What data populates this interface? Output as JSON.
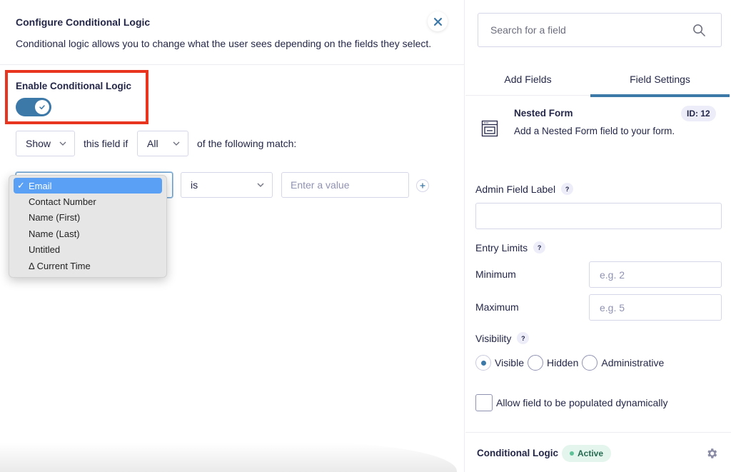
{
  "dialog": {
    "title": "Configure Conditional Logic",
    "description": "Conditional logic allows you to change what the user sees depending on the fields they select.",
    "close_icon": "close-icon"
  },
  "enable": {
    "label": "Enable Conditional Logic",
    "enabled": true
  },
  "rule_header": {
    "action_value": "Show",
    "text_this_field": "this field if",
    "logic_value": "All",
    "text_following": "of the following match:"
  },
  "rule": {
    "field_value": "Email",
    "operator_value": "is",
    "value_placeholder": "Enter a value",
    "add_icon": "plus-icon"
  },
  "field_dropdown": {
    "options": [
      {
        "label": "Email",
        "selected": true
      },
      {
        "label": "Contact Number",
        "selected": false
      },
      {
        "label": "Name (First)",
        "selected": false
      },
      {
        "label": "Name (Last)",
        "selected": false
      },
      {
        "label": "Untitled",
        "selected": false
      },
      {
        "label": "Δ Current Time",
        "selected": false
      }
    ],
    "check_glyph": "✓"
  },
  "sidebar": {
    "search_placeholder": "Search for a field",
    "tabs": [
      {
        "label": "Add Fields",
        "active": false
      },
      {
        "label": "Field Settings",
        "active": true
      }
    ],
    "field": {
      "name": "Nested Form",
      "description": "Add a Nested Form field to your form.",
      "id_badge": "ID: 12",
      "icon": "nested-form-icon"
    },
    "admin_label": {
      "label": "Admin Field Label",
      "help": "?",
      "value": ""
    },
    "entry_limits": {
      "label": "Entry Limits",
      "help": "?",
      "minimum_label": "Minimum",
      "minimum_placeholder": "e.g. 2",
      "maximum_label": "Maximum",
      "maximum_placeholder": "e.g. 5"
    },
    "visibility": {
      "label": "Visibility",
      "help": "?",
      "options": [
        {
          "label": "Visible",
          "checked": true
        },
        {
          "label": "Hidden",
          "checked": false
        },
        {
          "label": "Administrative",
          "checked": false
        }
      ]
    },
    "dynamic_population": {
      "label": "Allow field to be populated dynamically",
      "checked": false
    },
    "conditional_logic": {
      "label": "Conditional Logic",
      "status": "Active",
      "status_color": "#5fc198"
    }
  },
  "colors": {
    "accent": "#3c79a8",
    "highlight_border": "#e8351f",
    "dropdown_selected": "#5aa0f5",
    "active_badge_bg": "#e3f5ec"
  }
}
